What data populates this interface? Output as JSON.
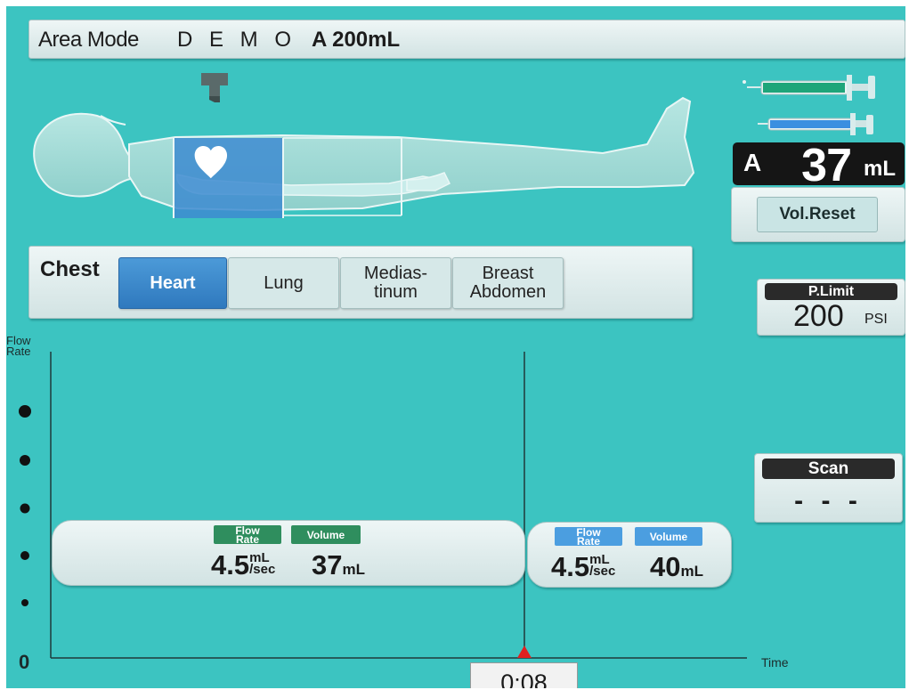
{
  "header": {
    "mode_label": "Area Mode",
    "demo_label": "D E M O",
    "syringe_volume": "A 200mL"
  },
  "volume_display": {
    "syringe": "A",
    "value": "37",
    "unit": "mL",
    "reset_label": "Vol.Reset"
  },
  "pressure_limit": {
    "title": "P.Limit",
    "value": "200",
    "unit": "PSI"
  },
  "scan": {
    "title": "Scan",
    "value": "- - -"
  },
  "region": {
    "label": "Chest",
    "options": [
      {
        "line1": "Heart",
        "line2": ""
      },
      {
        "line1": "Lung",
        "line2": ""
      },
      {
        "line1": "Medias-",
        "line2": "tinum"
      },
      {
        "line1": "Breast",
        "line2": "Abdomen"
      }
    ],
    "selected": "Heart"
  },
  "graph": {
    "y_label_line1": "Flow",
    "y_label_line2": "Rate",
    "y_zero": "0",
    "x_label": "Time",
    "elapsed_time": "0:08"
  },
  "phases": [
    {
      "flow_tag_line1": "Flow",
      "flow_tag_line2": "Rate",
      "volume_tag": "Volume",
      "flow_rate": "4.5",
      "flow_unit_top": "mL",
      "flow_unit_bottom": "/sec",
      "volume": "37",
      "volume_unit": "mL",
      "tag_color": "#2f8e5e"
    },
    {
      "flow_tag_line1": "Flow",
      "flow_tag_line2": "Rate",
      "volume_tag": "Volume",
      "flow_rate": "4.5",
      "flow_unit_top": "mL",
      "flow_unit_bottom": "/sec",
      "volume": "40",
      "volume_unit": "mL",
      "tag_color": "#4b9ee0"
    }
  ],
  "colors": {
    "screen_bg": "#3cc4c1",
    "selected_button": "#3d8bd0",
    "marker": "#e02020"
  }
}
